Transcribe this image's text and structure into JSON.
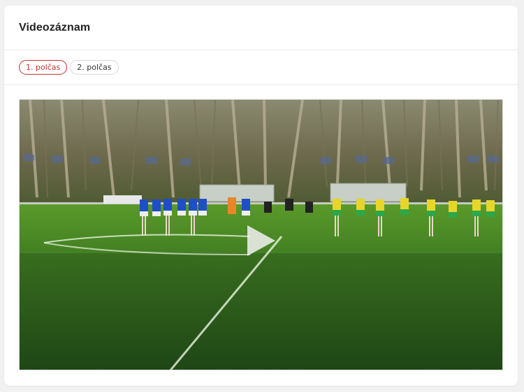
{
  "section": {
    "title": "Videozáznam"
  },
  "tabs": [
    {
      "label": "1. polčas",
      "active": true
    },
    {
      "label": "2. polčas",
      "active": false
    }
  ],
  "colors": {
    "accent": "#c9302c",
    "home_kit": "#1f4fc4",
    "away_kit": "#e6d62a",
    "away_shorts": "#2aa84a",
    "referee_kit": "#222222"
  },
  "video": {
    "play_icon": "play-icon"
  }
}
